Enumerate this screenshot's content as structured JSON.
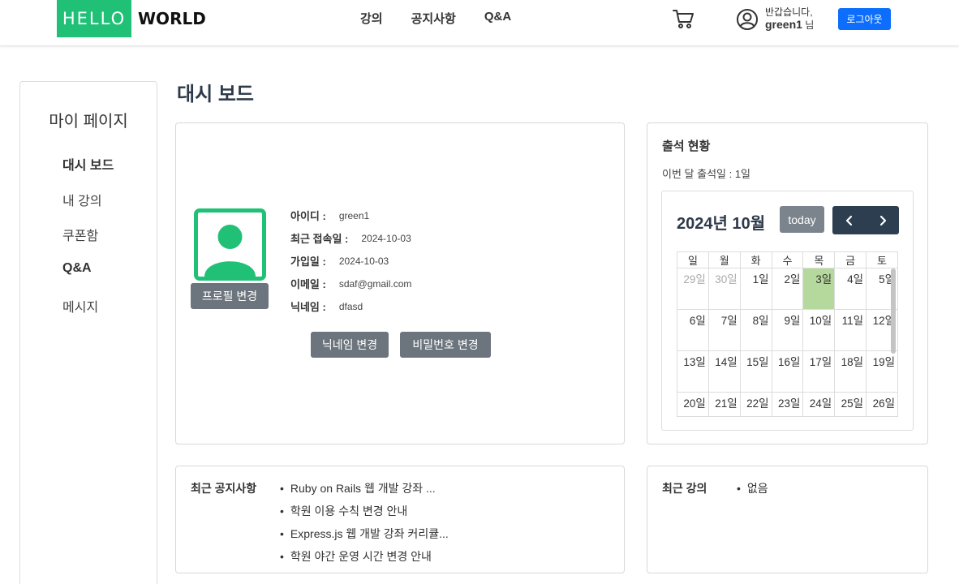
{
  "header": {
    "logo_hello": "HELLO",
    "logo_world": "WORLD",
    "nav": [
      "강의",
      "공지사항",
      "Q&A"
    ],
    "greeting": "반갑습니다,",
    "username": "green1",
    "honorific": "님",
    "logout": "로그아웃"
  },
  "sidebar": {
    "title": "마이 페이지",
    "items": [
      "대시 보드",
      "내 강의",
      "쿠폰함",
      "Q&A",
      "메시지"
    ]
  },
  "page_title": "대시 보드",
  "profile": {
    "change_profile": "프로필 변경",
    "rows": [
      {
        "label": "아이디 :",
        "value": "green1"
      },
      {
        "label": "최근 접속일 :",
        "value": "2024-10-03"
      },
      {
        "label": "가입일 :",
        "value": "2024-10-03"
      },
      {
        "label": "이메일 :",
        "value": "sdaf@gmail.com"
      },
      {
        "label": "닉네임 :",
        "value": "dfasd"
      }
    ],
    "change_nickname": "닉네임 변경",
    "change_password": "비밀번호 변경"
  },
  "attendance": {
    "title": "출석 현황",
    "count_text": "이번 달 출석일 : 1일",
    "month": "2024년 10월",
    "today": "today",
    "weekdays": [
      "일",
      "월",
      "화",
      "수",
      "목",
      "금",
      "토"
    ],
    "weeks": [
      [
        "29일",
        "30일",
        "1일",
        "2일",
        "3일",
        "4일",
        "5일"
      ],
      [
        "6일",
        "7일",
        "8일",
        "9일",
        "10일",
        "11일",
        "12일"
      ],
      [
        "13일",
        "14일",
        "15일",
        "16일",
        "17일",
        "18일",
        "19일"
      ],
      [
        "20일",
        "21일",
        "22일",
        "23일",
        "24일",
        "25일",
        "26일"
      ]
    ],
    "attended_color": "#b5d99c"
  },
  "notices": {
    "label": "최근 공지사항",
    "items": [
      "Ruby on Rails 웹 개발 강좌 ...",
      "학원 이용 수칙 변경 안내",
      "Express.js 웹 개발 강좌 커리큘...",
      "학원 야간 운영 시간 변경 안내"
    ]
  },
  "recent": {
    "label": "최근 강의",
    "items": [
      "없음"
    ]
  },
  "colors": {
    "brand_green": "#20c177",
    "primary_blue": "#0d6efd",
    "dark_navy": "#2c3e50",
    "button_gray": "#6c757d"
  }
}
